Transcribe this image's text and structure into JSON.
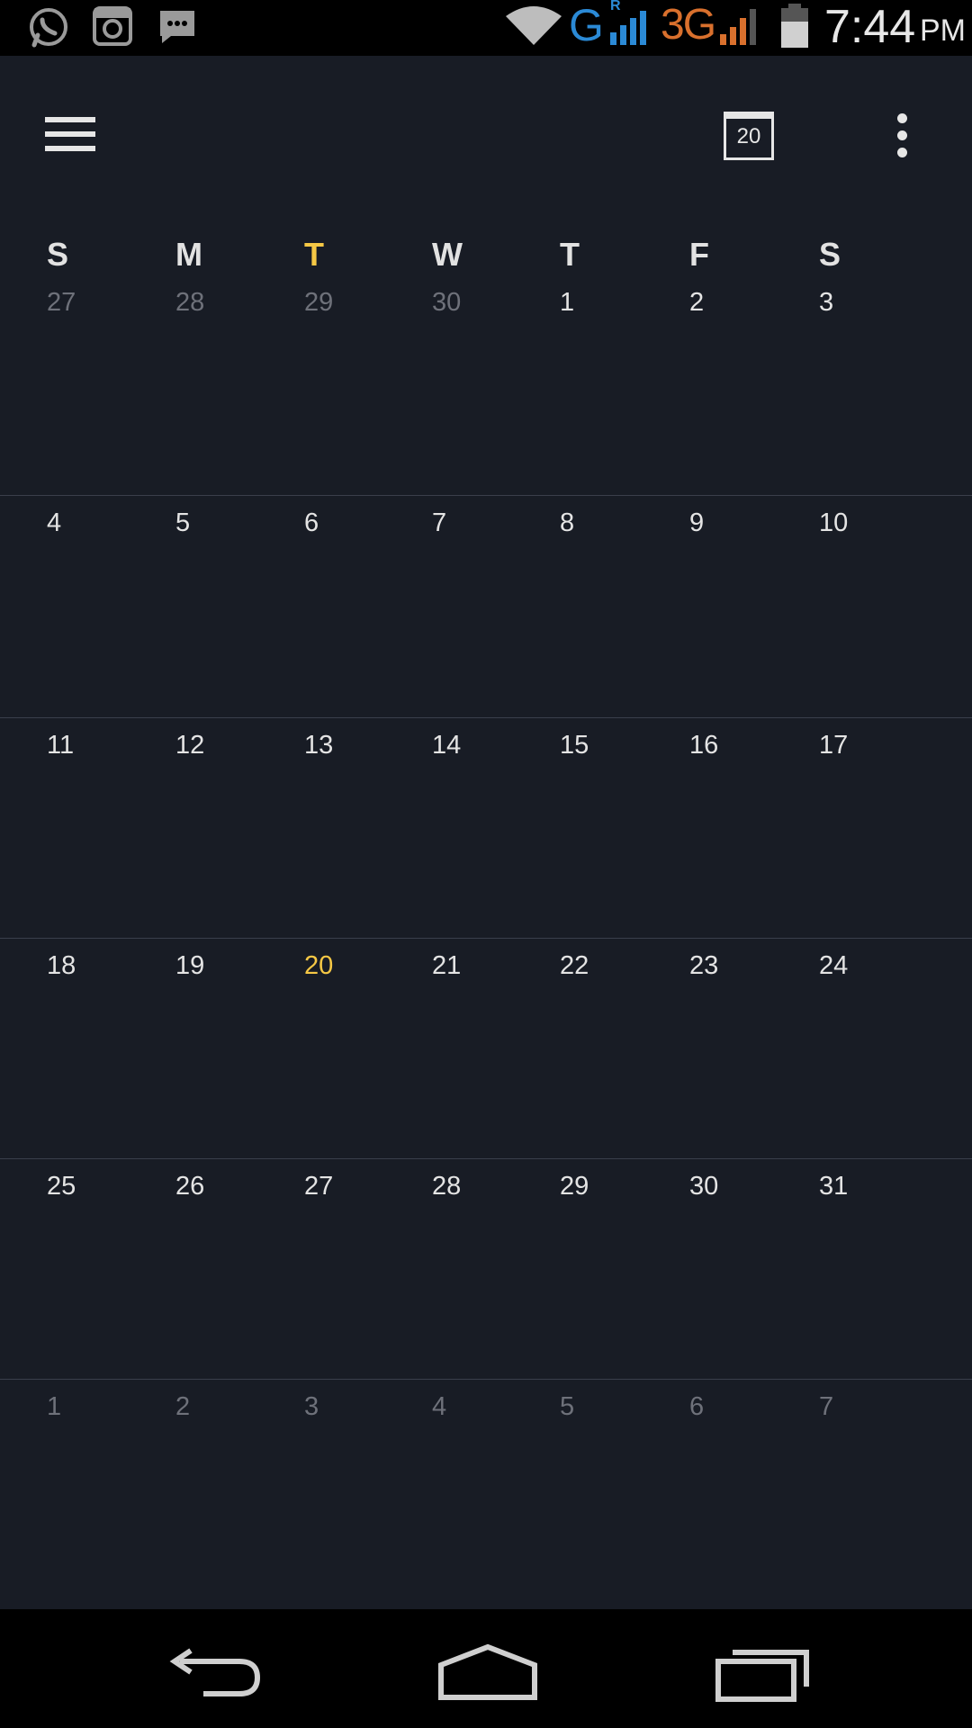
{
  "status_bar": {
    "icons_left": [
      "whatsapp-icon",
      "instagram-icon",
      "sms-icon"
    ],
    "network_g": "G",
    "roaming": "R",
    "network_3g": "3G",
    "time": "7:44",
    "ampm": "PM"
  },
  "toolbar": {
    "today_date": "20"
  },
  "weekdays": [
    {
      "label": "S"
    },
    {
      "label": "M"
    },
    {
      "label": "T",
      "today": true
    },
    {
      "label": "W"
    },
    {
      "label": "T"
    },
    {
      "label": "F"
    },
    {
      "label": "S"
    }
  ],
  "weeks": [
    [
      {
        "d": "27",
        "muted": true
      },
      {
        "d": "28",
        "muted": true
      },
      {
        "d": "29",
        "muted": true
      },
      {
        "d": "30",
        "muted": true
      },
      {
        "d": "1"
      },
      {
        "d": "2"
      },
      {
        "d": "3"
      }
    ],
    [
      {
        "d": "4"
      },
      {
        "d": "5"
      },
      {
        "d": "6"
      },
      {
        "d": "7"
      },
      {
        "d": "8"
      },
      {
        "d": "9"
      },
      {
        "d": "10"
      }
    ],
    [
      {
        "d": "11"
      },
      {
        "d": "12"
      },
      {
        "d": "13"
      },
      {
        "d": "14"
      },
      {
        "d": "15"
      },
      {
        "d": "16"
      },
      {
        "d": "17"
      }
    ],
    [
      {
        "d": "18"
      },
      {
        "d": "19"
      },
      {
        "d": "20",
        "today": true
      },
      {
        "d": "21"
      },
      {
        "d": "22"
      },
      {
        "d": "23"
      },
      {
        "d": "24"
      }
    ],
    [
      {
        "d": "25"
      },
      {
        "d": "26"
      },
      {
        "d": "27"
      },
      {
        "d": "28"
      },
      {
        "d": "29"
      },
      {
        "d": "30"
      },
      {
        "d": "31"
      }
    ],
    [
      {
        "d": "1",
        "muted": true
      },
      {
        "d": "2",
        "muted": true
      },
      {
        "d": "3",
        "muted": true
      },
      {
        "d": "4",
        "muted": true
      },
      {
        "d": "5",
        "muted": true
      },
      {
        "d": "6",
        "muted": true
      },
      {
        "d": "7",
        "muted": true
      }
    ]
  ],
  "colors": {
    "background": "#181c25",
    "today_accent": "#f6c845",
    "muted_text": "#6e717a",
    "divider": "#3a3f4b"
  },
  "nav_bar": {
    "icons": [
      "back-icon",
      "home-icon",
      "recent-apps-icon"
    ]
  }
}
